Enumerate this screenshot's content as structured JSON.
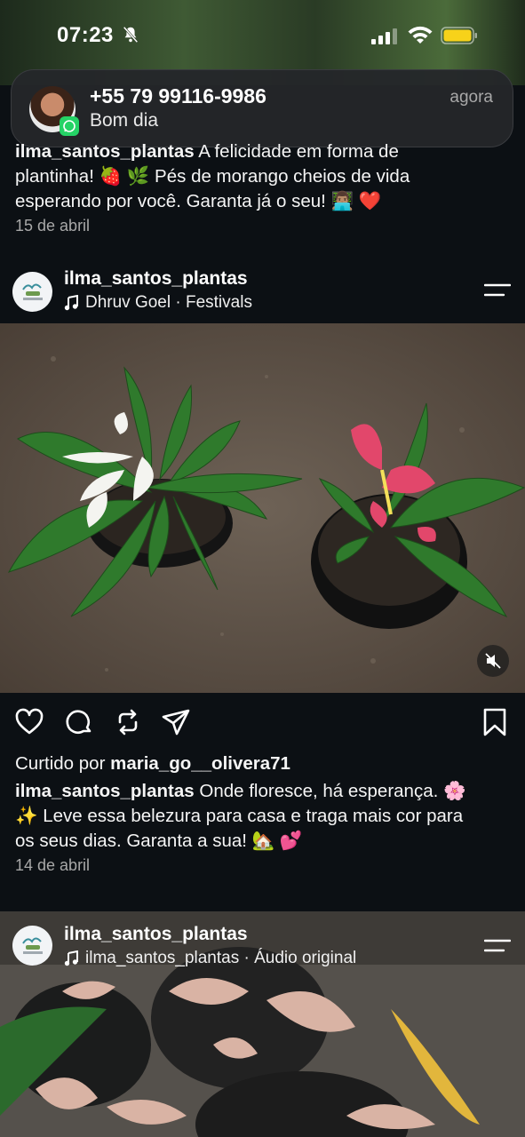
{
  "status_bar": {
    "time": "07:23",
    "icons": [
      "bell-slash-icon",
      "signal-icon",
      "wifi-icon",
      "battery-icon"
    ],
    "battery_color": "#f7d21a"
  },
  "notification": {
    "app": "WhatsApp",
    "title": "+55 79 99116-9986",
    "body": "Bom dia",
    "time": "agora",
    "badge_color": "#25d366"
  },
  "prev_post": {
    "username": "ilma_santos_plantas",
    "caption_line1": " A felicidade em forma de",
    "caption_line2": "plantinha! 🍓 🌿 Pés de morango cheios de vida",
    "caption_line3": "esperando por você. Garanta já o seu! 👨🏽‍💻 ❤️",
    "date": "15 de abril"
  },
  "post": {
    "username": "ilma_santos_plantas",
    "audio": "Dhruv Goel · Festivals",
    "liked_prefix": "Curtido por ",
    "liked_by": "maria_go__olivera71",
    "caption_user": "ilma_santos_plantas",
    "caption_line1": " Onde floresce, há esperança. 🌸",
    "caption_line2": "✨ Leve essa belezura para casa e traga mais cor para",
    "caption_line3": "os seus dias. Garanta a sua! 🏡 💕",
    "date": "14 de abril"
  },
  "next_post": {
    "username": "ilma_santos_plantas",
    "audio": "ilma_santos_plantas · Áudio original"
  }
}
